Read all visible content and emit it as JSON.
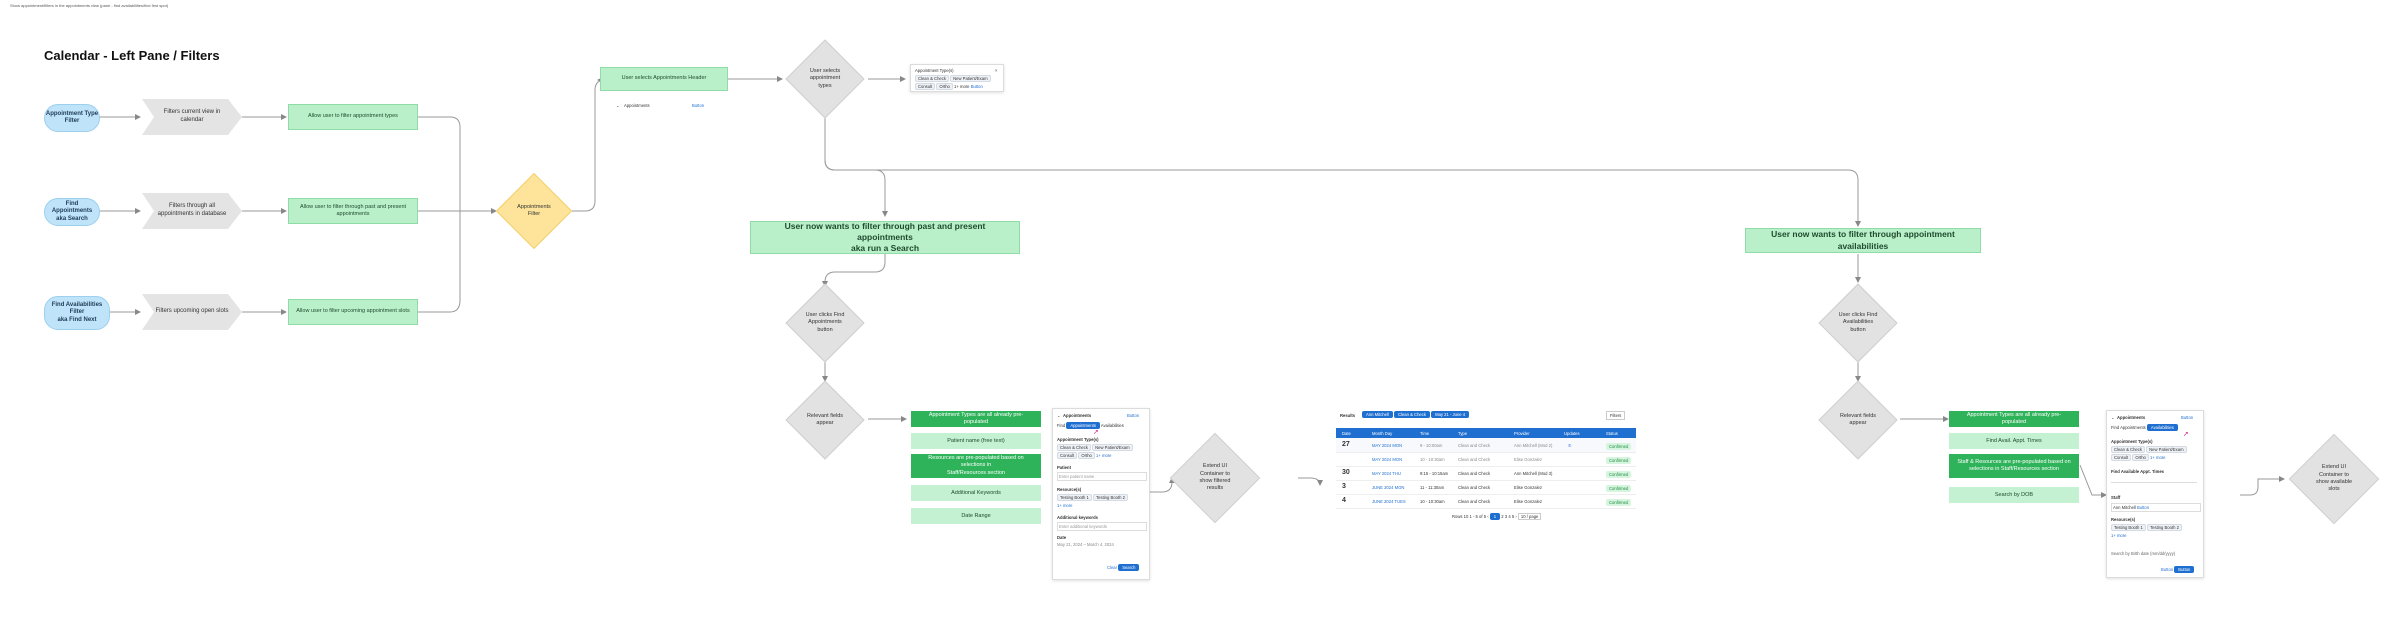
{
  "note": "Show appointment/filters in the appointments view (pane - find availabilities/find first spot)",
  "title": "Calendar - Left Pane / Filters",
  "entry_pills": [
    "Appointment Type\nFilter",
    "Find Appointments\naka Search",
    "Find Availabilities\nFilter\naka Find Next"
  ],
  "chevrons": [
    "Filters current view in calendar",
    "Filters through all\nappointments in database",
    "Filters upcoming open slots"
  ],
  "allow_boxes": [
    "Allow user to filter appointment types",
    "Allow user to filter through past and present\nappointments",
    "Allow user to filter upcoming appointment slots"
  ],
  "appointments_filter": "Appointments\nFilter",
  "user_selects_header": "User selects Appointments Header",
  "user_selects_types": "User selects\nappointment\ntypes",
  "header_strip": {
    "label": "Appointments",
    "action": "Button"
  },
  "types_popup": {
    "title": "Appointment Type(s)",
    "chips": [
      "Clean & Check",
      "New Patient/Exam",
      "Consult",
      "Ortho",
      "1+ more"
    ],
    "link": "Button"
  },
  "banner_search": "User now wants to filter through past and present appointments\naka run a Search",
  "banner_avail": "User now wants to filter through appointment availabilities",
  "click_find_appts": "User clicks Find\nAppointments\nbutton",
  "click_find_avail": "User clicks Find\nAvailabilities\nbutton",
  "relevant_fields_1": "Relevant fields\nappear",
  "relevant_fields_2": "Relevant fields\nappear",
  "search_fields": [
    {
      "text": "Appointment Types are all already pre-populated",
      "style": "dark"
    },
    {
      "text": "Patient name (free text)",
      "style": "light"
    },
    {
      "text": "Resources are pre-populated based on selections in\nStaff/Resources section",
      "style": "dark"
    },
    {
      "text": "Additional Keywords",
      "style": "light"
    },
    {
      "text": "Date Range",
      "style": "light"
    }
  ],
  "avail_fields": [
    {
      "text": "Appointment Types are all already pre-populated",
      "style": "dark"
    },
    {
      "text": "Find Avail. Appt. Times",
      "style": "light"
    },
    {
      "text": "Staff & Resources are pre-populated based on\nselections in Staff/Resources section",
      "style": "dark"
    },
    {
      "text": "Search by DOB",
      "style": "light"
    }
  ],
  "search_panel": {
    "header": "Appointments",
    "header_action": "Button",
    "tabs": [
      "Find",
      "Appointments",
      "Availabilities"
    ],
    "types_label": "Appointment Type(s)",
    "types_chips": [
      "Clean & Check",
      "New Patient/Exam",
      "Consult",
      "Ortho",
      "1+ more"
    ],
    "patient_label": "Patient",
    "patient_placeholder": "Enter patient name",
    "resources_label": "Resource(s)",
    "resources_chips": [
      "Testing Booth 1",
      "Testing Booth 2",
      "1+ more"
    ],
    "keywords_label": "Additional keywords",
    "keywords_placeholder": "Enter additional keywords",
    "date_label": "Date",
    "date_from": "May 21, 2024",
    "date_to": "March 4, 2024",
    "clear": "Clear",
    "search": "Search"
  },
  "extend_ui_1": "Extend UI\nContainer to\nshow filtered\nresults",
  "extend_ui_2": "Extend UI\nContainer to\nshow available\nslots",
  "results": {
    "label": "Results",
    "chips": [
      "Ann Mitchell",
      "Clean & Check",
      "May 21 - June 4"
    ],
    "filters": "Filters",
    "columns": [
      "Date",
      "Month Day",
      "Time",
      "Type",
      "Provider",
      "Updates",
      "Status"
    ],
    "rows": [
      {
        "d": "27",
        "md": "MAY 2024 MON",
        "t": "9 - 10:00am",
        "type": "Clean and Check",
        "p": "Ann Mitchell (Mod 2)",
        "s": "Confirmed"
      },
      {
        "d": "",
        "md": "MAY 2024 MON",
        "t": "10 - 10:30am",
        "type": "Clean and Check",
        "p": "Elise Gonzalez",
        "s": "Confirmed"
      },
      {
        "d": "30",
        "md": "MAY 2024 THU",
        "t": "9:15 - 10:15am",
        "type": "Clean and Check",
        "p": "Ann Mitchell (Mod 3)",
        "s": "Confirmed"
      },
      {
        "d": "3",
        "md": "JUNE 2024 MON",
        "t": "11 - 11:30am",
        "type": "Clean and Check",
        "p": "Elise Gonzalez",
        "s": "Confirmed"
      },
      {
        "d": "4",
        "md": "JUNE 2024 TUES",
        "t": "10 - 10:30am",
        "type": "Clean and Check",
        "p": "Elise Gonzalez",
        "s": "Confirmed"
      }
    ],
    "pagination": {
      "rows_label": "Rows",
      "rows_value": "10",
      "viewing": "1 - 5 of 5",
      "pages": [
        "1",
        "2",
        "3",
        "4",
        "5"
      ],
      "per_page": "10 / page"
    }
  },
  "avail_panel": {
    "header": "Appointments",
    "header_action": "Button",
    "tabs": [
      "Find",
      "Appointments",
      "Availabilities"
    ],
    "types_label": "Appointment Type(s)",
    "types_chips": [
      "Clean & Check",
      "New Patient/Exam",
      "Consult",
      "Ortho",
      "1+ more"
    ],
    "find_label": "Find Available Appt. Times",
    "staff_label": "Staff",
    "staff_chips": [
      "Ann Mitchell",
      "Button"
    ],
    "resources_label": "Resource(s)",
    "resources_chips": [
      "Testing Booth 1",
      "Testing Booth 2",
      "1+ more"
    ],
    "dob_label": "Search by Birth date (mm/dd/yyyy)",
    "btn1": "Button",
    "btn2": "Button"
  }
}
